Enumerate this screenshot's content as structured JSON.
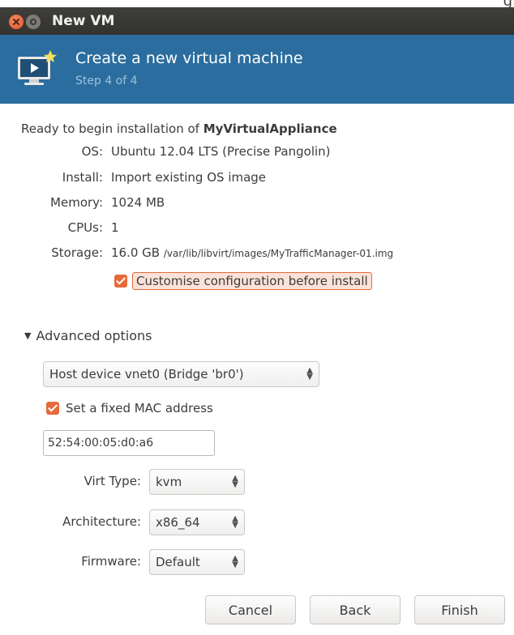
{
  "corner_text": "g",
  "window": {
    "title": "New VM"
  },
  "banner": {
    "title": "Create a new virtual machine",
    "step": "Step 4 of 4"
  },
  "summary": {
    "intro": "Ready to begin installation of ",
    "vm_name": "MyVirtualAppliance",
    "rows": [
      {
        "label": "OS:",
        "value": "Ubuntu 12.04 LTS (Precise Pangolin)"
      },
      {
        "label": "Install:",
        "value": "Import existing OS image"
      },
      {
        "label": "Memory:",
        "value": "1024 MB"
      },
      {
        "label": "CPUs:",
        "value": "1"
      },
      {
        "label": "Storage:",
        "value": "16.0 GB",
        "path": "/var/lib/libvirt/images/MyTrafficManager-01.img"
      }
    ],
    "customise_label": "Customise configuration before install",
    "customise_checked": true
  },
  "advanced": {
    "label": "Advanced options",
    "network_select": "Host device vnet0 (Bridge 'br0')",
    "fixed_mac_label": "Set a fixed MAC address",
    "fixed_mac_checked": true,
    "mac_value": "52:54:00:05:d0:a6",
    "virt_type_label": "Virt Type:",
    "virt_type_value": "kvm",
    "arch_label": "Architecture:",
    "arch_value": "x86_64",
    "firmware_label": "Firmware:",
    "firmware_value": "Default"
  },
  "buttons": {
    "cancel": "Cancel",
    "back": "Back",
    "finish": "Finish"
  },
  "colors": {
    "accent": "#e66a3a",
    "banner": "#2b6d9e",
    "titlebar": "#3a3935"
  }
}
